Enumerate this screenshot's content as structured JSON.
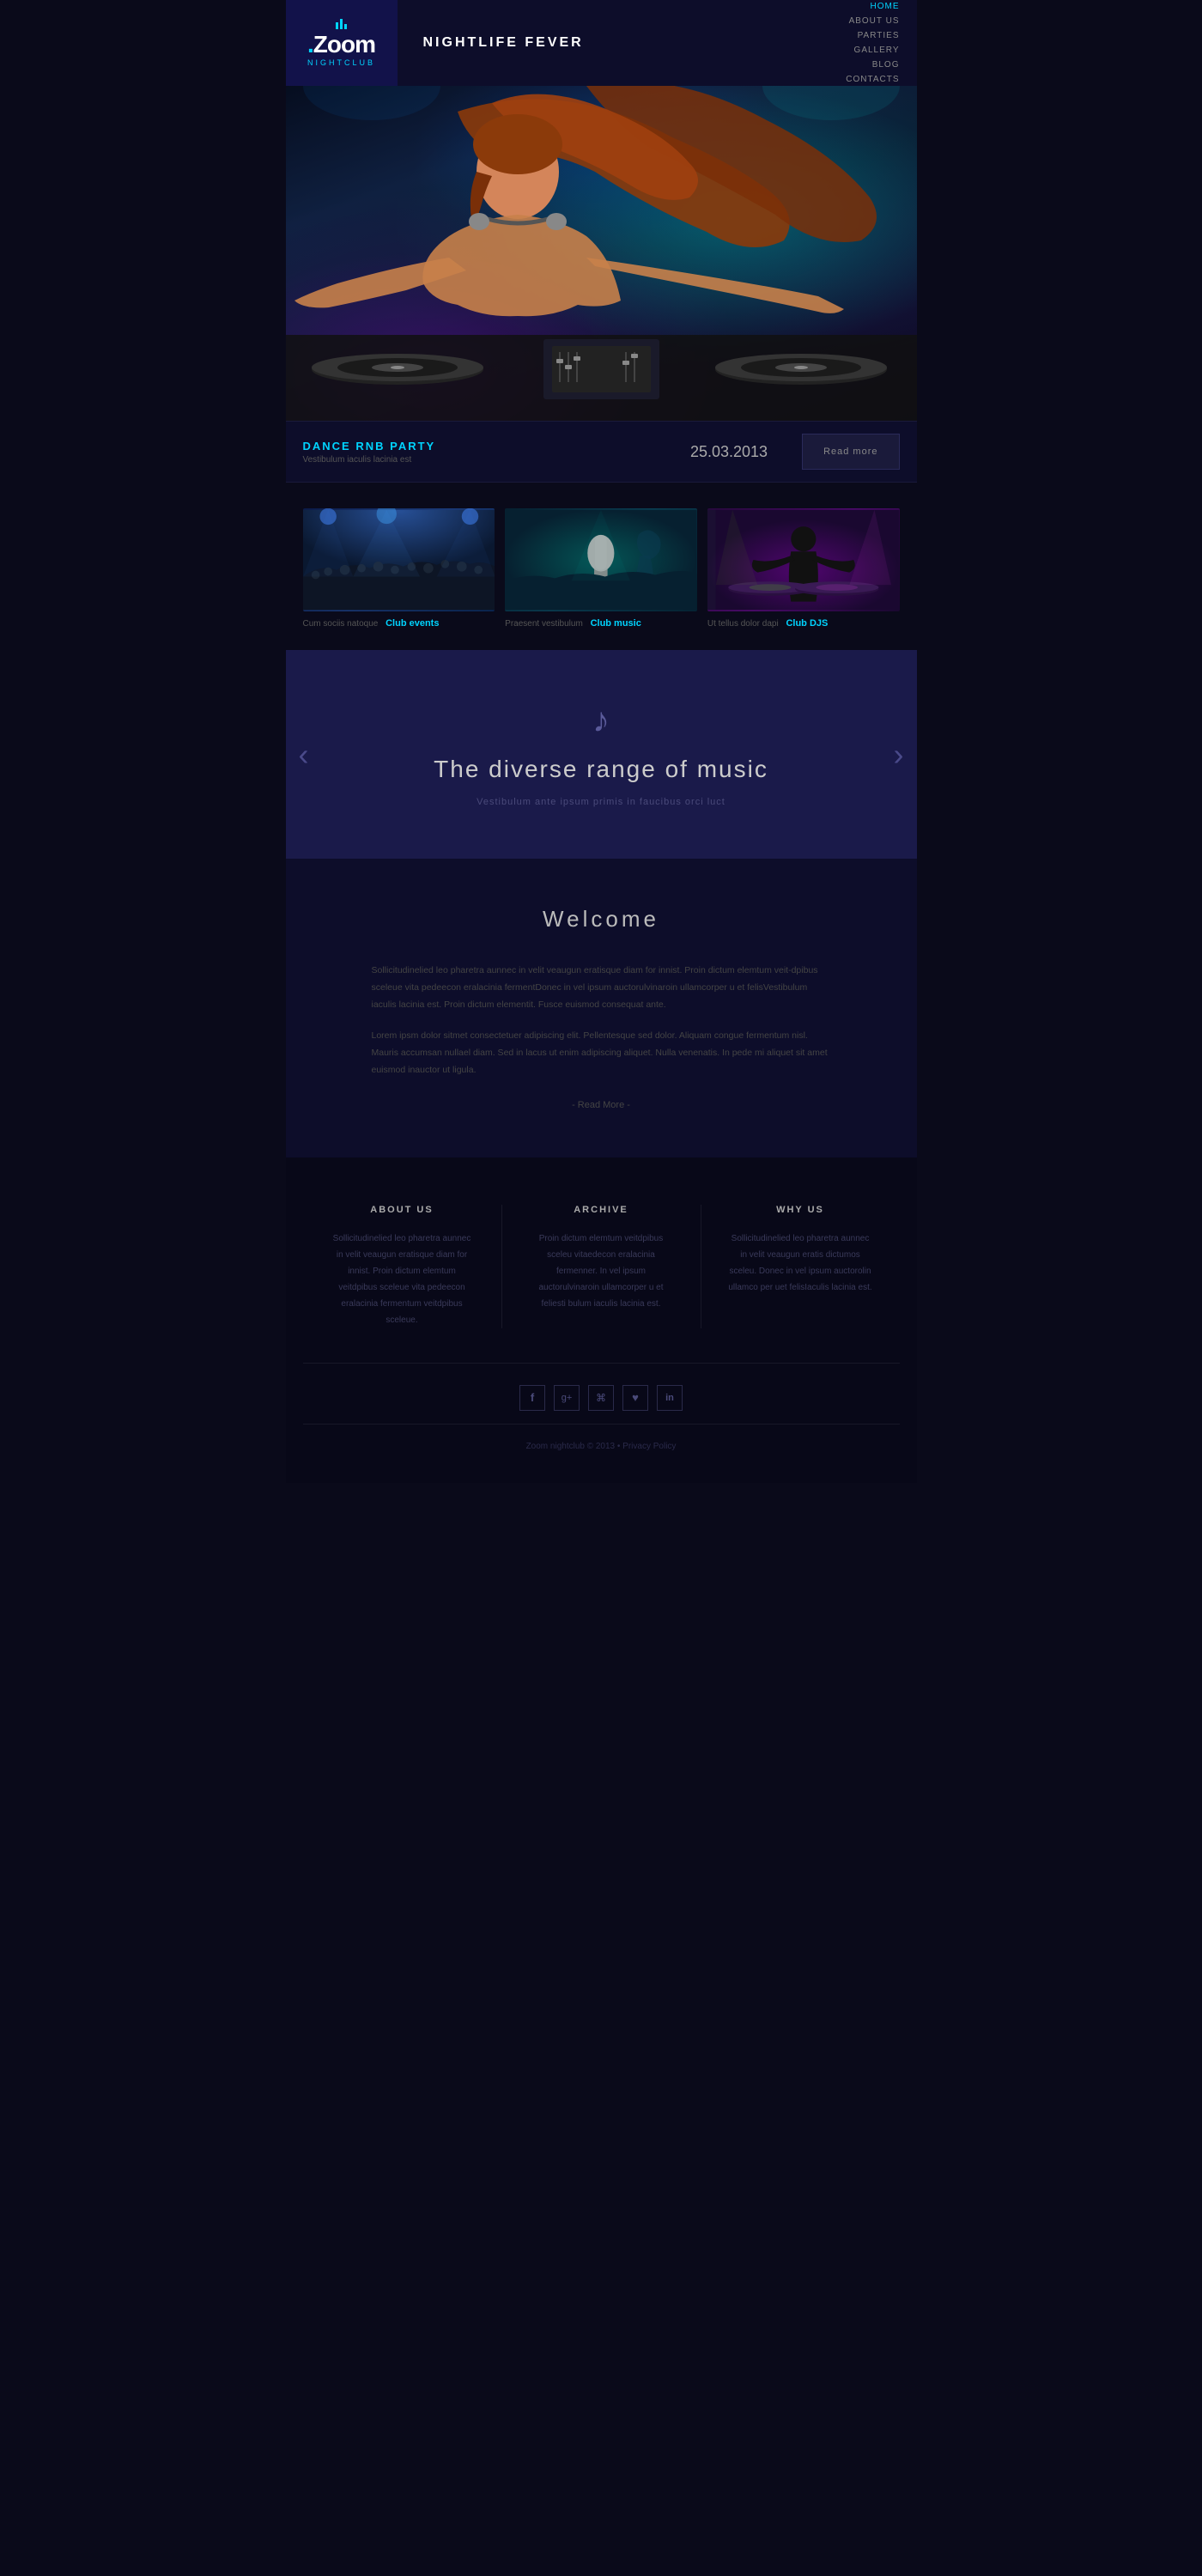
{
  "logo": {
    "name": "Zoom",
    "sub": "NIGHTCLUB",
    "dot": "."
  },
  "header": {
    "site_title": "NIGHTLIFE FEVER",
    "nav": [
      {
        "label": "HOME",
        "active": true
      },
      {
        "label": "ABOUT US",
        "active": false
      },
      {
        "label": "PARTIES",
        "active": false
      },
      {
        "label": "GALLERY",
        "active": false
      },
      {
        "label": "BLOG",
        "active": false
      },
      {
        "label": "CONTACTS",
        "active": false
      }
    ]
  },
  "event_bar": {
    "title": "DANCE RNB PARTY",
    "subtitle": "Vestibulum iaculis lacinia est",
    "date": "25.03.2013",
    "button": "Read more"
  },
  "gallery": {
    "items": [
      {
        "pre_label": "Cum sociis natoque",
        "label": "Club events"
      },
      {
        "pre_label": "Praesent vestibulum",
        "label": "Club music"
      },
      {
        "pre_label": "Ut tellus dolor dapi",
        "label": "Club DJS"
      }
    ]
  },
  "slider": {
    "icon": "♪",
    "title": "The diverse range of music",
    "subtitle": "Vestibulum ante ipsum primis in faucibus orci luct",
    "left_arrow": "‹",
    "right_arrow": "›"
  },
  "welcome": {
    "title": "Welcome",
    "paragraph1": "Sollicitudinelied leo pharetra aunnec in velit veaugun eratisque diam for innist. Proin dictum elemtum veit-dpibus sceleue vita pedeecon eralacinia fermentDonec in vel ipsum auctorulvinaroin ullamcorper u et felisVestibulum iaculis lacinia est. Proin dictum elementit. Fusce euismod consequat ante.",
    "paragraph2": "Lorem ipsm dolor sitmet consectetuer adipiscing elit. Pellentesque sed dolor. Aliquam congue fermentum nisl. Mauris accumsan nullael diam. Sed in lacus ut enim adipiscing aliquet. Nulla venenatis. In pede mi aliquet sit amet euismod inauctor ut ligula.",
    "read_more": "- Read More -"
  },
  "footer": {
    "cols": [
      {
        "title": "ABOUT US",
        "text": "Sollicitudinelied leo pharetra aunnec in velit veaugun eratisque diam for innist. Proin dictum elemtum veitdpibus sceleue vita pedeecon eralacinia fermentum veitdpibus sceleue."
      },
      {
        "title": "ARCHIVE",
        "text": "Proin dictum elemtum veitdpibus sceleu vitaedecon eralacinia fermenner. In vel ipsum auctorulvinaroin ullamcorper u et feliesti bulum iaculis lacinia est."
      },
      {
        "title": "WHY US",
        "text": "Sollicitudinelied leo pharetra aunnec in velit veaugun eratis dictumos sceleu. Donec in vel ipsum auctorolin ullamco per uet felisIaculis lacinia est."
      }
    ],
    "social_icons": [
      "f",
      "g+",
      "rss",
      "♥",
      "in"
    ],
    "copyright": "Zoom nightclub © 2013 • Privacy Policy"
  }
}
